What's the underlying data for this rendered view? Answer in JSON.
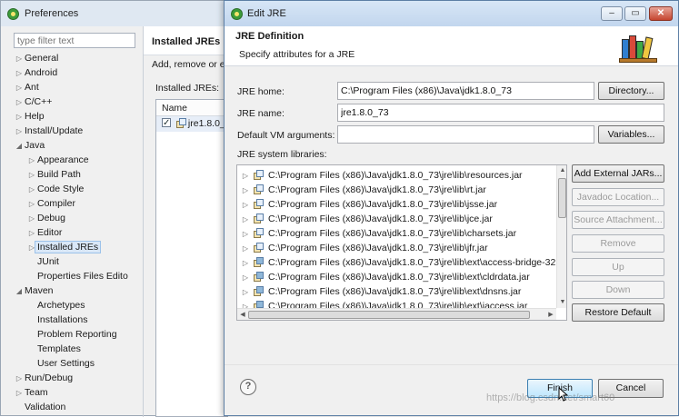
{
  "preferences": {
    "title": "Preferences",
    "filter_placeholder": "type filter text",
    "tree": [
      {
        "label": "General",
        "expanded": false,
        "level": 0
      },
      {
        "label": "Android",
        "expanded": false,
        "level": 0
      },
      {
        "label": "Ant",
        "expanded": false,
        "level": 0
      },
      {
        "label": "C/C++",
        "expanded": false,
        "level": 0
      },
      {
        "label": "Help",
        "expanded": false,
        "level": 0
      },
      {
        "label": "Install/Update",
        "expanded": false,
        "level": 0
      },
      {
        "label": "Java",
        "expanded": true,
        "level": 0
      },
      {
        "label": "Appearance",
        "expanded": false,
        "level": 1
      },
      {
        "label": "Build Path",
        "expanded": false,
        "level": 1
      },
      {
        "label": "Code Style",
        "expanded": false,
        "level": 1
      },
      {
        "label": "Compiler",
        "expanded": false,
        "level": 1
      },
      {
        "label": "Debug",
        "expanded": false,
        "level": 1
      },
      {
        "label": "Editor",
        "expanded": false,
        "level": 1
      },
      {
        "label": "Installed JREs",
        "expanded": false,
        "level": 1,
        "selected": true
      },
      {
        "label": "JUnit",
        "level": 1
      },
      {
        "label": "Properties Files Edito",
        "level": 1
      },
      {
        "label": "Maven",
        "expanded": true,
        "level": 0
      },
      {
        "label": "Archetypes",
        "level": 1
      },
      {
        "label": "Installations",
        "level": 1
      },
      {
        "label": "Problem Reporting",
        "level": 1
      },
      {
        "label": "Templates",
        "level": 1
      },
      {
        "label": "User Settings",
        "level": 1
      },
      {
        "label": "Run/Debug",
        "expanded": false,
        "level": 0
      },
      {
        "label": "Team",
        "expanded": false,
        "level": 0
      },
      {
        "label": "Validation",
        "level": 0
      }
    ],
    "page_title": "Installed JREs",
    "page_desc": "Add, remove or e",
    "installed_label": "Installed JREs:",
    "table_header": "Name",
    "table_row": "jre1.8.0_7"
  },
  "dialog": {
    "title": "Edit JRE",
    "window_buttons": [
      "–",
      "▭",
      "✕"
    ],
    "header_title": "JRE Definition",
    "header_desc": "Specify attributes for a JRE",
    "jre_home_label": "JRE home:",
    "jre_home_value": "C:\\Program Files (x86)\\Java\\jdk1.8.0_73",
    "directory_button": "Directory...",
    "jre_name_label": "JRE name:",
    "jre_name_value": "jre1.8.0_73",
    "vm_args_label": "Default VM arguments:",
    "vm_args_value": "",
    "variables_button": "Variables...",
    "libs_label": "JRE system libraries:",
    "libraries": [
      {
        "path": "C:\\Program Files (x86)\\Java\\jdk1.8.0_73\\jre\\lib\\resources.jar",
        "icon": "jar-icon"
      },
      {
        "path": "C:\\Program Files (x86)\\Java\\jdk1.8.0_73\\jre\\lib\\rt.jar",
        "icon": "jar-icon"
      },
      {
        "path": "C:\\Program Files (x86)\\Java\\jdk1.8.0_73\\jre\\lib\\jsse.jar",
        "icon": "jar-icon"
      },
      {
        "path": "C:\\Program Files (x86)\\Java\\jdk1.8.0_73\\jre\\lib\\jce.jar",
        "icon": "jar-icon"
      },
      {
        "path": "C:\\Program Files (x86)\\Java\\jdk1.8.0_73\\jre\\lib\\charsets.jar",
        "icon": "jar-icon"
      },
      {
        "path": "C:\\Program Files (x86)\\Java\\jdk1.8.0_73\\jre\\lib\\jfr.jar",
        "icon": "jar-icon"
      },
      {
        "path": "C:\\Program Files (x86)\\Java\\jdk1.8.0_73\\jre\\lib\\ext\\access-bridge-32",
        "icon": "jar-binary-icon"
      },
      {
        "path": "C:\\Program Files (x86)\\Java\\jdk1.8.0_73\\jre\\lib\\ext\\cldrdata.jar",
        "icon": "jar-binary-icon"
      },
      {
        "path": "C:\\Program Files (x86)\\Java\\jdk1.8.0_73\\jre\\lib\\ext\\dnsns.jar",
        "icon": "jar-binary-icon"
      },
      {
        "path": "C:\\Program Files (x86)\\Java\\jdk1.8.0_73\\jre\\lib\\ext\\jaccess.jar",
        "icon": "jar-binary-icon"
      }
    ],
    "side_buttons": [
      {
        "label": "Add External JARs...",
        "enabled": true
      },
      {
        "label": "Javadoc Location...",
        "enabled": false
      },
      {
        "label": "Source Attachment...",
        "enabled": false
      },
      {
        "label": "Remove",
        "enabled": false
      },
      {
        "label": "Up",
        "enabled": false
      },
      {
        "label": "Down",
        "enabled": false
      },
      {
        "label": "Restore Default",
        "enabled": true
      }
    ],
    "help_symbol": "?",
    "finish_button": "Finish",
    "cancel_button": "Cancel"
  },
  "watermark": "https://blog.csdn.net/smart60"
}
